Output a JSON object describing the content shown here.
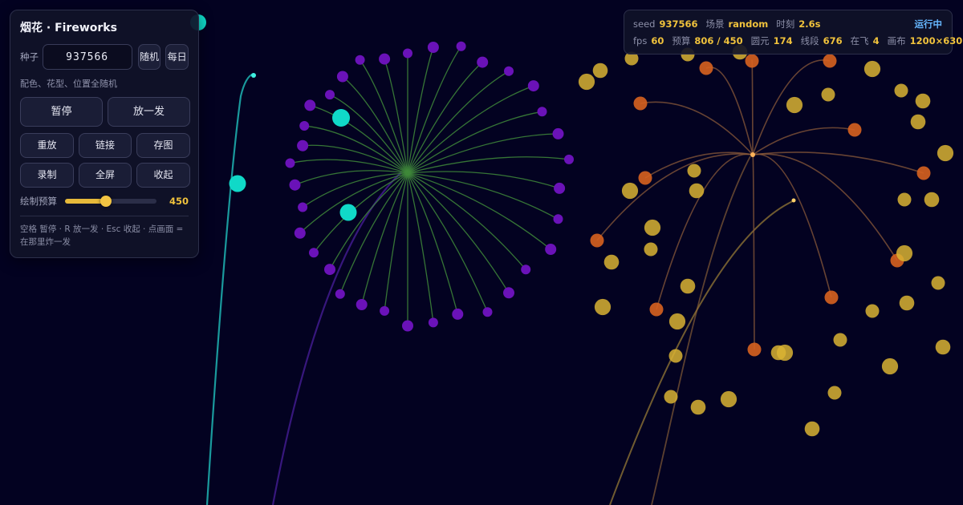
{
  "panel": {
    "title": "烟花 · Fireworks",
    "seed_label": "种子",
    "seed_value": "937566",
    "random_button": "随机",
    "daily_button": "每日",
    "hint": "配色、花型、位置全随机",
    "primary_buttons": {
      "pause": "暂停",
      "launch_one": "放一发"
    },
    "action_buttons": {
      "replay": "重放",
      "link": "链接",
      "save_image": "存图",
      "record": "录制",
      "fullscreen": "全屏",
      "collapse": "收起"
    },
    "budget_slider": {
      "label": "绘制预算",
      "value": 450,
      "min": 0,
      "max": 1000
    },
    "shortcut_hint": "空格 暂停 · R 放一发 · Esc 收起 · 点画面 = 在那里炸一发"
  },
  "status": {
    "seed_key": "seed",
    "seed_value": "937566",
    "scene_key": "场景",
    "scene_value": "random",
    "time_key": "时刻",
    "time_value": "2.6s",
    "state": "运行中",
    "fps_key": "fps",
    "fps_value": "60",
    "budget_key": "预算",
    "budget_value": "806 / 450",
    "circles_key": "圆元",
    "circles_value": "174",
    "segments_key": "线段",
    "segments_value": "676",
    "inflight_key": "在飞",
    "inflight_value": "4",
    "canvas_key": "画布",
    "canvas_value": "1200×630"
  },
  "colors": {
    "background": "#030221",
    "accent": "#f0c23c",
    "status_running": "#66b7ff",
    "purple_shell": "#6a12b8",
    "purple_trail": "#3f8a3a",
    "gold_shell": "#d9b332",
    "orange_shell": "#d7621f",
    "cyan_shell": "#10d9c8"
  }
}
